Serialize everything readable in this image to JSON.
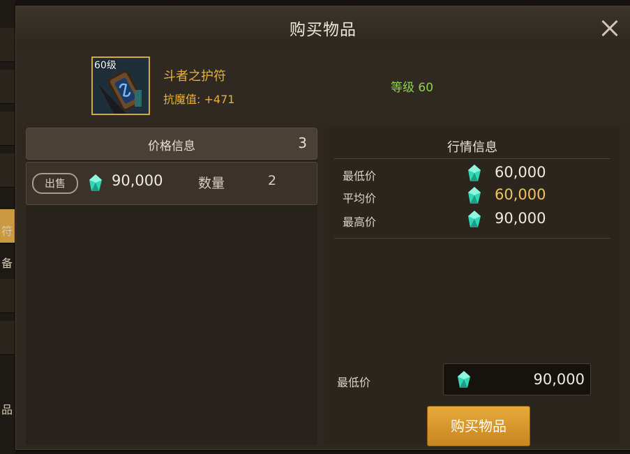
{
  "colors": {
    "item_name": "#e8b13a",
    "item_grade": "#8ed44a",
    "average_price": "#f2c35a",
    "buy_button": "#e7a93b",
    "gem": "#2fd7b4"
  },
  "sidebar": {
    "glyph_top": "符",
    "glyph_mid": "备",
    "glyph_bottom": "品"
  },
  "dialog": {
    "title": "购买物品",
    "close_icon": "close-icon"
  },
  "item": {
    "level_tag": "60级",
    "name": "斗者之护符",
    "stat": "抗魔值: +471",
    "grade": "等级 60",
    "icon": "amulet-icon"
  },
  "price_info": {
    "title": "价格信息",
    "count": "3",
    "listings": [
      {
        "badge": "出售",
        "price": "90,000",
        "quantity_label": "数量",
        "quantity": "2",
        "currency_icon": "gem-icon"
      }
    ]
  },
  "market_info": {
    "title": "行情信息",
    "rows": [
      {
        "label": "最低价",
        "value": "60,000"
      },
      {
        "label": "平均价",
        "value": "60,000"
      },
      {
        "label": "最高价",
        "value": "90,000"
      }
    ]
  },
  "purchase": {
    "min_price_label": "最低价",
    "min_price_value": "90,000",
    "buy_button_label": "购买物品"
  }
}
